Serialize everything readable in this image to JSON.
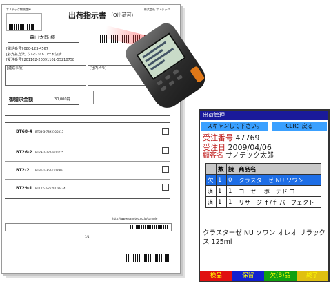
{
  "sheet": {
    "company_top_left": "サノテック物流倉庫",
    "title": "出荷指示書",
    "title_suffix": "（O出荷可）",
    "company_top_right": "株式会社 サノテック",
    "recipient": "森山太郎 様",
    "tel": "[電話番号] 080-123-4567",
    "payment": "[お支払方法] クレジットカード決済",
    "order_ref": "[受注番号] 201162-20091101-55210758",
    "notes_label": "[連絡事項]",
    "memo_label": "[社内メモ]",
    "billing_label": "御請求金額",
    "billing_amount": "30,000円",
    "rows": [
      {
        "code": "BT68-4",
        "sub": "BT68-3-7895100315"
      },
      {
        "code": "BT26-2",
        "sub": "BT29-2-2274400225"
      },
      {
        "code": "BT2-2",
        "sub": "BT31-1-3574102902"
      },
      {
        "code": "BT29-1",
        "sub": "BT102-3-2620100434"
      }
    ],
    "footer_url": "http://www.sanotec.co.jp/sample",
    "page_no": "1/1"
  },
  "device": {
    "title": "出荷管理",
    "message": "スキャンして下さい。",
    "clear_label": "CLR：戻る",
    "order_no_label": "受注番号",
    "order_no": "47769",
    "order_date_label": "受注日",
    "order_date": "2009/04/06",
    "customer_label": "顧客名",
    "customer": "サノテック太郎",
    "table_headers": [
      "",
      "数",
      "読",
      "商品名"
    ],
    "table_rows": [
      [
        "欠",
        "1",
        "0",
        "クラスターゼ NU ソワン"
      ],
      [
        "済",
        "1",
        "1",
        "コーセー ボーテド コー"
      ],
      [
        "済",
        "1",
        "1",
        "リサージ ｆ/ｆ パーフェクト"
      ]
    ],
    "detail_text": "クラスターゼ NU ソワン オレオ リラックス 125ml",
    "footer_buttons": [
      {
        "label": "検品",
        "bg": "#e01010"
      },
      {
        "label": "保留",
        "bg": "#1020d0"
      },
      {
        "label": "欠(B)品",
        "bg": "#10a010"
      },
      {
        "label": "終了",
        "bg": "#e0c010"
      }
    ]
  }
}
